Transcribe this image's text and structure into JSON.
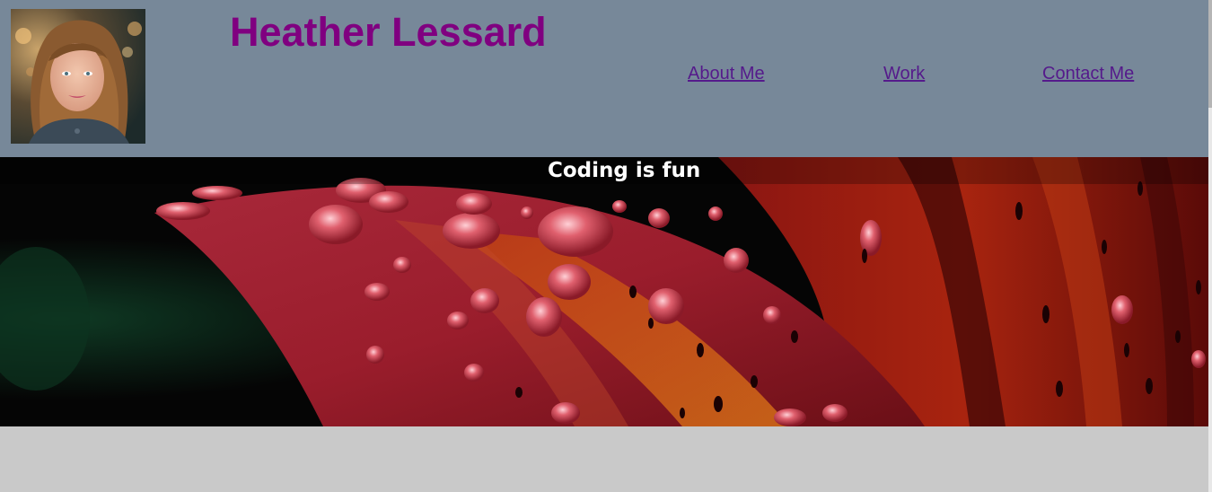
{
  "header": {
    "title": "Heather Lessard",
    "avatar_alt": "portrait photo",
    "background": "#778899",
    "title_color": "#800080"
  },
  "nav": {
    "about": "About Me",
    "work": "Work",
    "contact": "Contact Me",
    "link_color": "#551a8b"
  },
  "hero": {
    "tagline": "Coding is fun",
    "image": "red-lily-petal-with-water-droplets"
  },
  "page": {
    "background": "#c9c9c9"
  }
}
